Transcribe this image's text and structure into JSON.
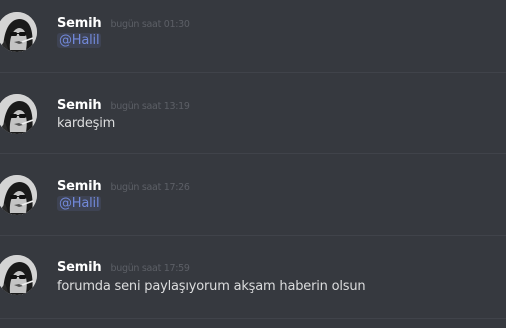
{
  "messages": [
    {
      "username": "Semih",
      "timestamp": "bugün saat 01:30",
      "text": "@Halil",
      "is_mention": true
    },
    {
      "username": "Semih",
      "timestamp": "bugün saat 13:19",
      "text": "kardeşim",
      "is_mention": false
    },
    {
      "username": "Semih",
      "timestamp": "bugün saat 17:26",
      "text": "@Halil",
      "is_mention": true
    },
    {
      "username": "Semih",
      "timestamp": "bugün saat 17:59",
      "text": "forumda seni paylaşıyorum akşam haberin olsun",
      "is_mention": false
    }
  ],
  "colors": {
    "background": "#36393f",
    "username": "#ffffff",
    "timestamp": "#5c5f66",
    "message_text": "#dcddde",
    "mention_text": "#7289da",
    "mention_background": "#3e4353",
    "divider": "#40434a"
  }
}
